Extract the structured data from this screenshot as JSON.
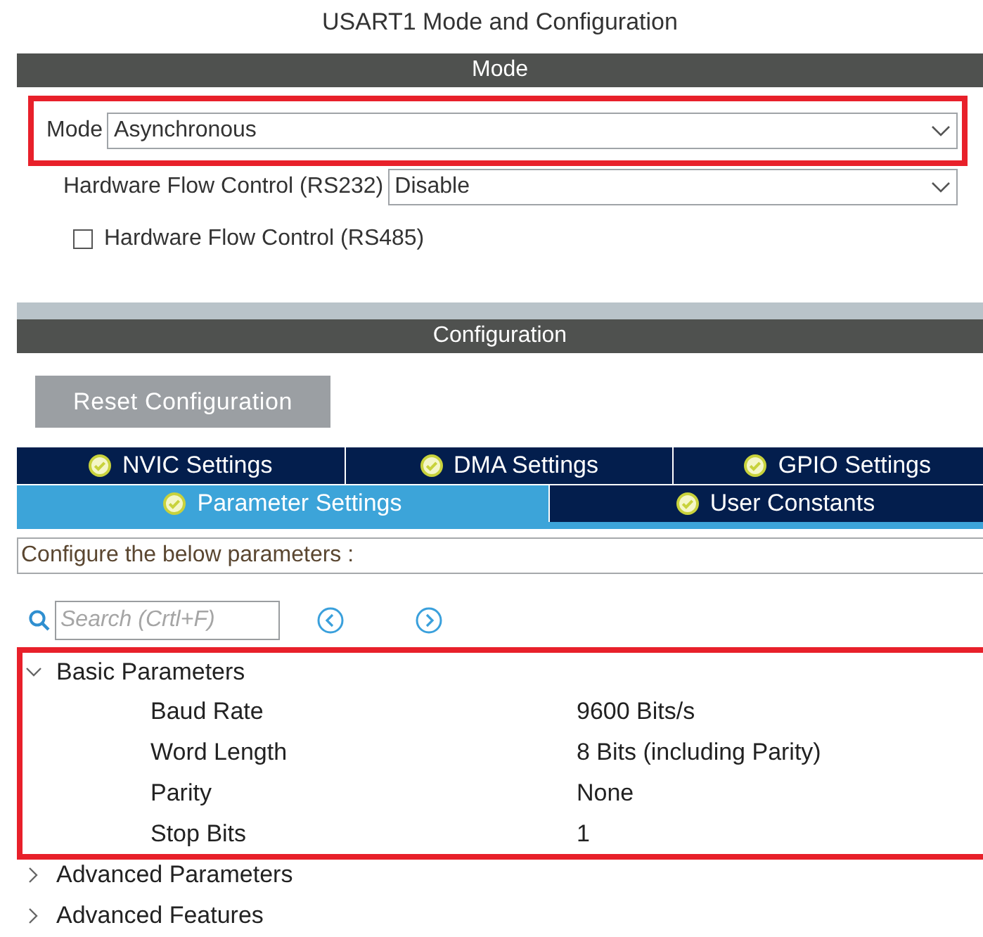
{
  "title": "USART1 Mode and Configuration",
  "mode_section": {
    "header": "Mode",
    "fields": [
      {
        "kind": "select",
        "label": "Mode",
        "value": "Asynchronous",
        "highlighted": true
      },
      {
        "kind": "select",
        "label": "Hardware Flow Control (RS232)",
        "value": "Disable",
        "highlighted": false
      },
      {
        "kind": "checkbox",
        "label": "Hardware Flow Control (RS485)",
        "checked": false
      }
    ]
  },
  "configuration_section": {
    "header": "Configuration",
    "reset_button": "Reset Configuration",
    "tabs": [
      [
        {
          "label": "NVIC Settings",
          "selected": false
        },
        {
          "label": "DMA Settings",
          "selected": false
        },
        {
          "label": "GPIO Settings",
          "selected": false
        }
      ],
      [
        {
          "label": "Parameter Settings",
          "selected": true
        },
        {
          "label": "User Constants",
          "selected": false
        }
      ]
    ],
    "description": "Configure the below parameters :",
    "search": {
      "placeholder": "Search (Crtl+F)"
    },
    "groups": [
      {
        "label": "Basic Parameters",
        "expanded": true,
        "highlighted": true,
        "children": [
          {
            "name": "Baud Rate",
            "value": "9600 Bits/s"
          },
          {
            "name": "Word Length",
            "value": "8 Bits (including Parity)"
          },
          {
            "name": "Parity",
            "value": "None"
          },
          {
            "name": "Stop Bits",
            "value": "1"
          }
        ]
      },
      {
        "label": "Advanced Parameters",
        "expanded": false,
        "highlighted": false
      },
      {
        "label": "Advanced Features",
        "expanded": false,
        "highlighted": false
      }
    ]
  }
}
